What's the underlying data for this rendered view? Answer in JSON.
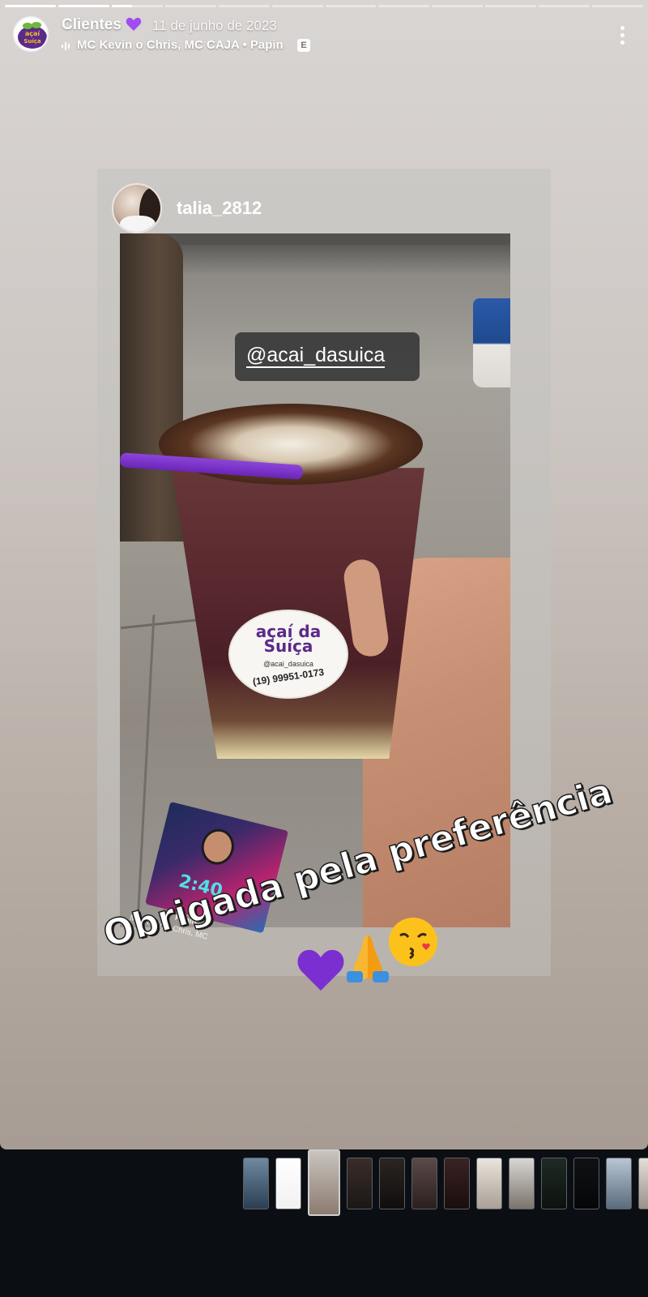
{
  "story": {
    "progress_segments": 12,
    "progress_current_index": 2,
    "progress_current_fraction": 0.4
  },
  "header": {
    "username": "Clientes",
    "date": "11 de junho de 2023",
    "music": "MC Kevin o Chris, MC CAJA • Papin",
    "explicit_badge": "E",
    "icons": [
      "heart-icon",
      "music-icon",
      "more-icon"
    ]
  },
  "shared_post": {
    "username": "talia_2812",
    "mention": "@acai_dasuica",
    "cup_label": {
      "brand": "açaí da Suíça",
      "handle": "@acai_dasuica",
      "phone": "(19) 99951-0173"
    }
  },
  "music_sticker": {
    "badge": "2:40",
    "song": "Papin",
    "artist": "MC Kevin o Chris, MC"
  },
  "caption": {
    "text": "Obrigada pela preferência",
    "emojis": [
      "purple-heart",
      "folded-hands",
      "kissing-face"
    ]
  },
  "colors": {
    "accent_purple": "#6a25b8",
    "strip_background": "#0b0e12"
  },
  "thumbnails": [
    {
      "name": "story-thumb-1"
    },
    {
      "name": "story-thumb-2"
    },
    {
      "name": "story-thumb-3",
      "current": true
    },
    {
      "name": "story-thumb-4"
    },
    {
      "name": "story-thumb-5"
    },
    {
      "name": "story-thumb-6"
    },
    {
      "name": "story-thumb-7"
    },
    {
      "name": "story-thumb-8"
    },
    {
      "name": "story-thumb-9"
    },
    {
      "name": "story-thumb-10"
    },
    {
      "name": "story-thumb-11"
    },
    {
      "name": "story-thumb-12"
    },
    {
      "name": "story-thumb-13"
    }
  ]
}
